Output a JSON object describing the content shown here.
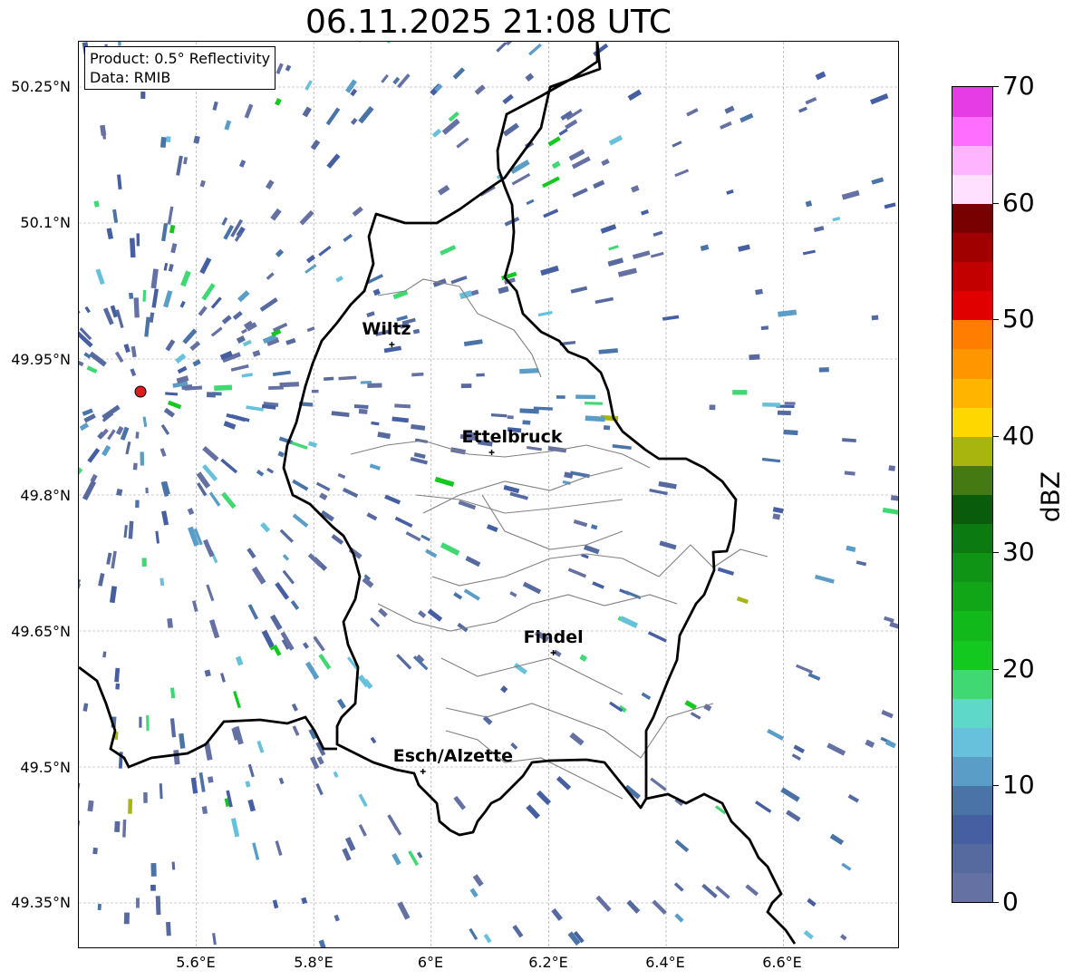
{
  "title": "06.11.2025 21:08 UTC",
  "info": {
    "product": "Product: 0.5° Reflectivity",
    "source": "Data: RMIB"
  },
  "map": {
    "lon_range": [
      5.4,
      6.8
    ],
    "lat_range": [
      49.3,
      50.3
    ],
    "lat_ticks": [
      "50.25°N",
      "50.1°N",
      "49.95°N",
      "49.8°N",
      "49.65°N",
      "49.5°N",
      "49.35°N"
    ],
    "lon_ticks": [
      "5.6°E",
      "5.8°E",
      "6°E",
      "6.2°E",
      "6.4°E",
      "6.6°E"
    ],
    "radar_site": {
      "lon": 5.505,
      "lat": 49.914,
      "color": "#e31a1c"
    },
    "cities": [
      {
        "name": "Wiltz",
        "lon": 5.933,
        "lat": 49.966
      },
      {
        "name": "Ettelbruck",
        "lon": 6.103,
        "lat": 49.847
      },
      {
        "name": "Findel",
        "lon": 6.208,
        "lat": 49.626
      },
      {
        "name": "Esch/Alzette",
        "lon": 5.986,
        "lat": 49.495
      }
    ],
    "border_color": "#000000",
    "district_color": "#808080"
  },
  "colorbar": {
    "label": "dBZ",
    "ticks": [
      "0",
      "10",
      "20",
      "30",
      "40",
      "50",
      "60",
      "70"
    ],
    "range": [
      0,
      70
    ],
    "colors": [
      "#6570a3",
      "#566aa0",
      "#465fa3",
      "#4a73a8",
      "#5a9ec8",
      "#67c1dc",
      "#5ed8c8",
      "#3fd873",
      "#13c81e",
      "#11b91b",
      "#11a617",
      "#0f9415",
      "#0b7a10",
      "#085c0b",
      "#457a12",
      "#a8b50e",
      "#ffd700",
      "#ffb400",
      "#ff9600",
      "#ff7d00",
      "#e00000",
      "#c20000",
      "#a00000",
      "#780000",
      "#ffe1ff",
      "#ffb4ff",
      "#ff6eff",
      "#e63ce6"
    ]
  }
}
